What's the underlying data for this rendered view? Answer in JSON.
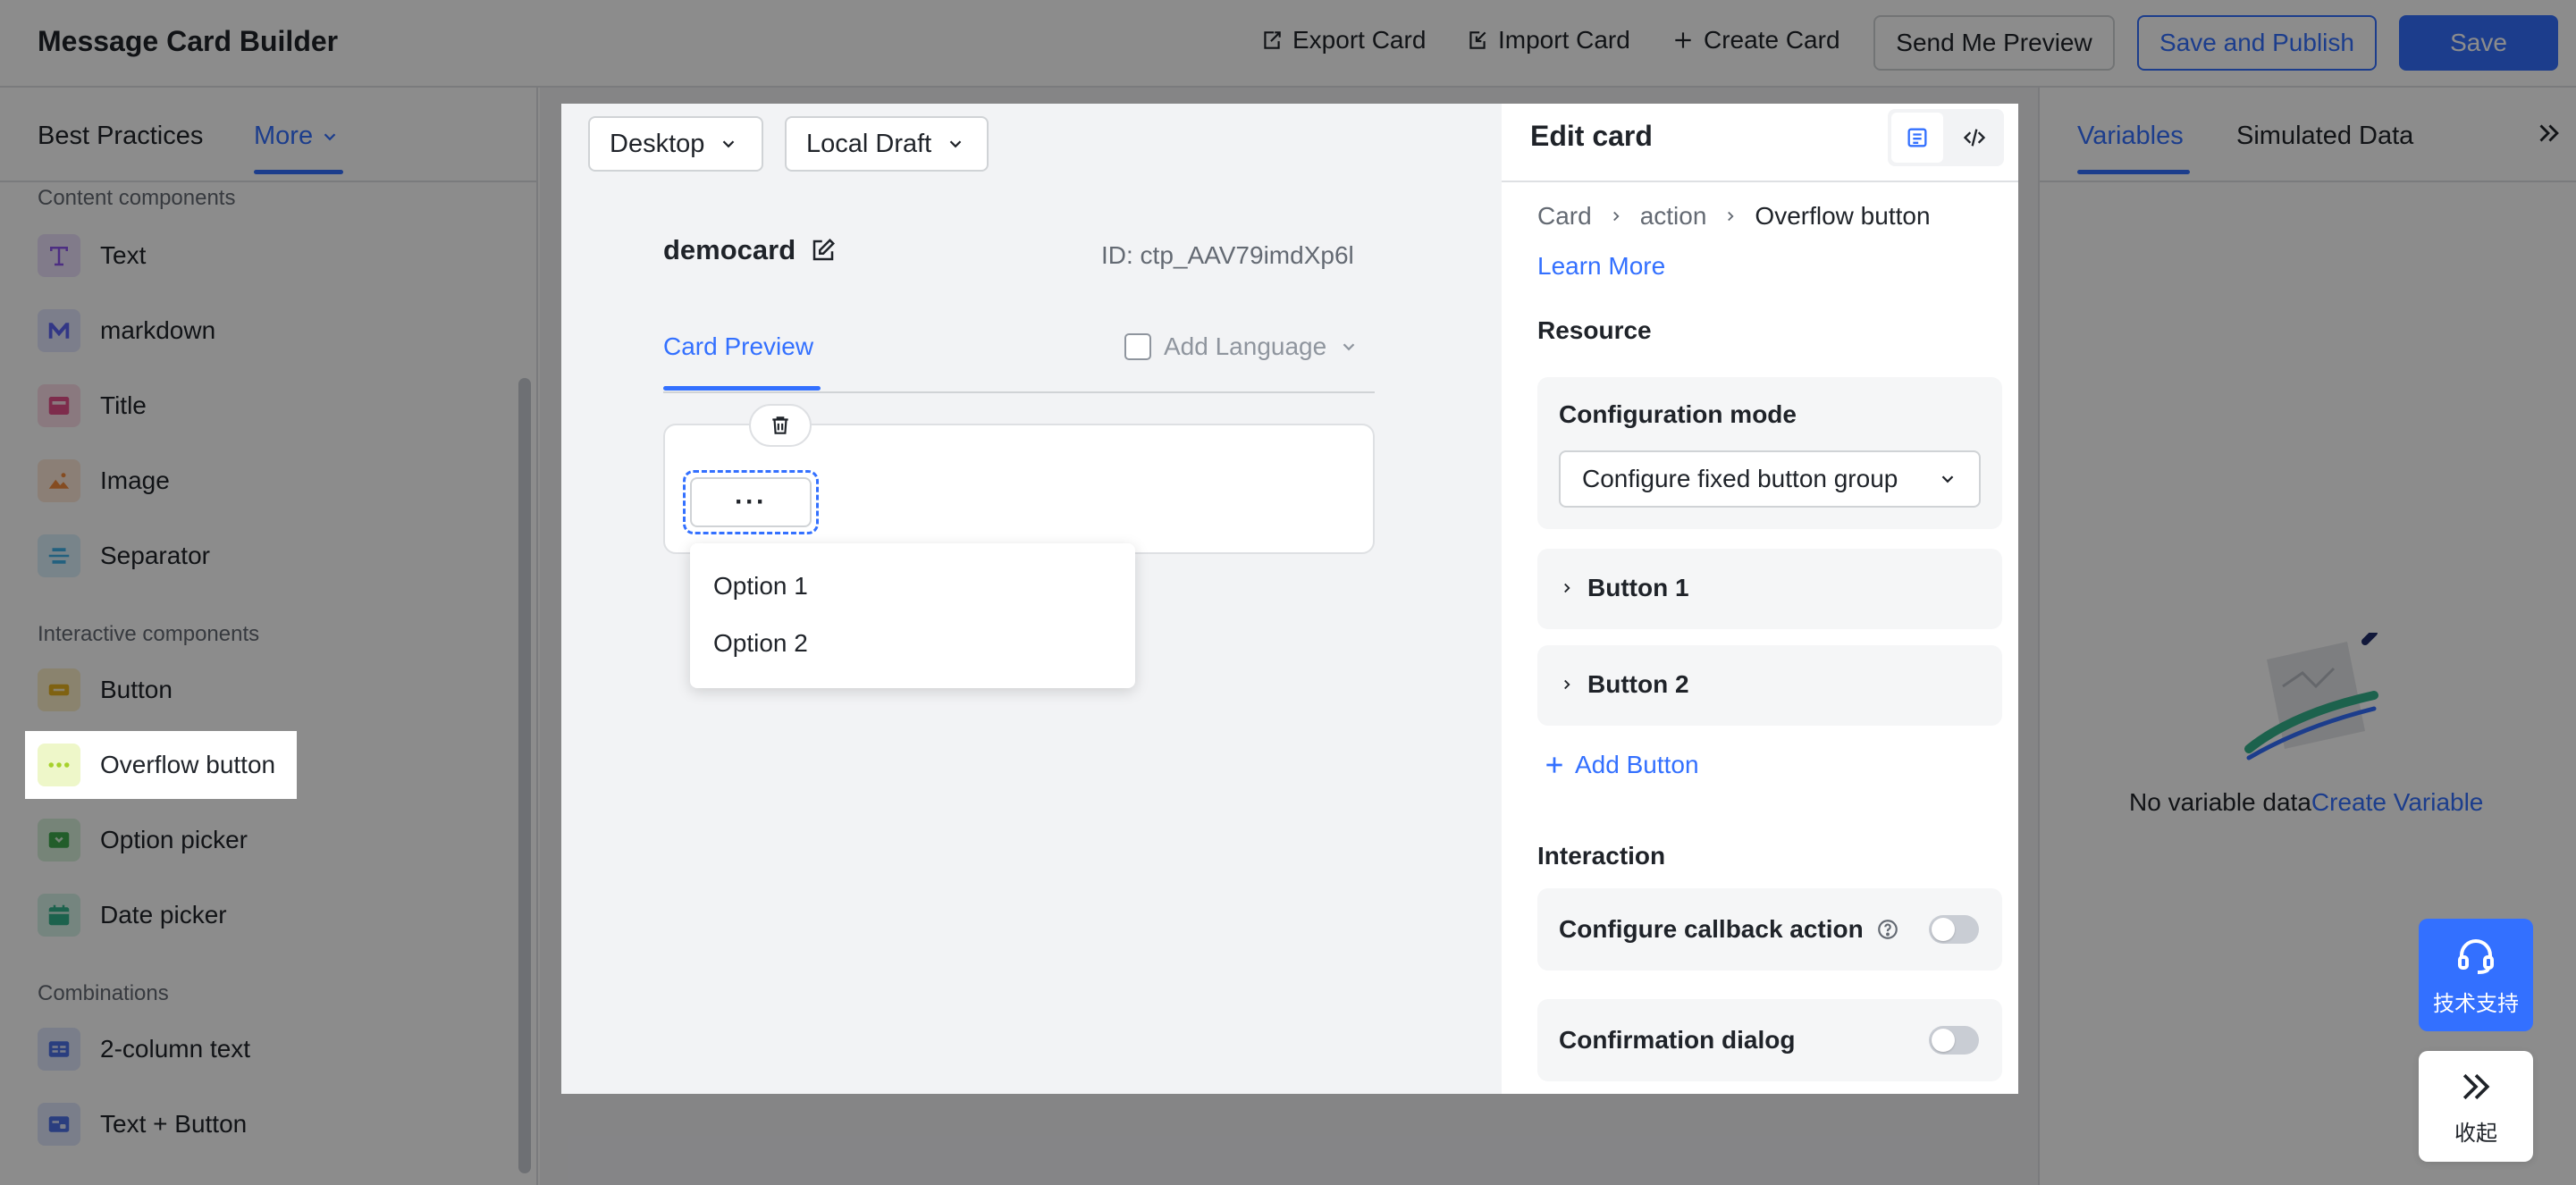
{
  "header": {
    "title": "Message Card Builder",
    "export_label": "Export Card",
    "import_label": "Import Card",
    "create_label": "Create Card",
    "preview_label": "Send Me Preview",
    "publish_label": "Save and Publish",
    "save_label": "Save"
  },
  "sidebar": {
    "tabs": [
      "Best Practices",
      "More"
    ],
    "sections": {
      "content": "Content components",
      "interactive": "Interactive components",
      "combinations": "Combinations"
    },
    "items": [
      {
        "label": "Text",
        "icon": "text-icon",
        "color": "#8d55ed"
      },
      {
        "label": "markdown",
        "icon": "markdown-icon",
        "color": "#5b65f5"
      },
      {
        "label": "Title",
        "icon": "title-icon",
        "color": "#e5508a"
      },
      {
        "label": "Image",
        "icon": "image-icon",
        "color": "#f28b3c"
      },
      {
        "label": "Separator",
        "icon": "separator-icon",
        "color": "#41b1e8"
      },
      {
        "label": "Button",
        "icon": "button-icon",
        "color": "#e8b21f"
      },
      {
        "label": "Overflow button",
        "icon": "overflow-icon",
        "color": "#a6d12b"
      },
      {
        "label": "Option picker",
        "icon": "option-picker-icon",
        "color": "#3faa4e"
      },
      {
        "label": "Date picker",
        "icon": "date-picker-icon",
        "color": "#34b38c"
      },
      {
        "label": "2-column text",
        "icon": "two-column-icon",
        "color": "#4e72e8"
      },
      {
        "label": "Text + Button",
        "icon": "text-button-icon",
        "color": "#4e72e8"
      }
    ]
  },
  "canvas": {
    "device": "Desktop",
    "draft": "Local Draft",
    "card_name": "democard",
    "card_id": "ID: ctp_AAV79imdXp6l",
    "preview_tab": "Card Preview",
    "add_language": "Add Language",
    "overflow_glyph": "···",
    "dropdown_options": [
      "Option 1",
      "Option 2"
    ]
  },
  "editor": {
    "title": "Edit card",
    "breadcrumb": [
      "Card",
      "action",
      "Overflow button"
    ],
    "learn_more": "Learn More",
    "resource_title": "Resource",
    "config_mode_label": "Configuration mode",
    "config_mode_value": "Configure fixed button group",
    "buttons": [
      "Button 1",
      "Button 2"
    ],
    "add_button": "Add Button",
    "interaction_title": "Interaction",
    "callback_label": "Configure callback action",
    "confirm_label": "Confirmation dialog"
  },
  "right_panel": {
    "tabs": [
      "Variables",
      "Simulated Data"
    ],
    "empty_text": "No variable data",
    "create_link": "Create Variable"
  },
  "floating": {
    "support_label": "技术支持",
    "collapse_label": "收起"
  },
  "colors": {
    "accent": "#3370ff",
    "overlay": "rgba(0,0,0,0.45)"
  }
}
